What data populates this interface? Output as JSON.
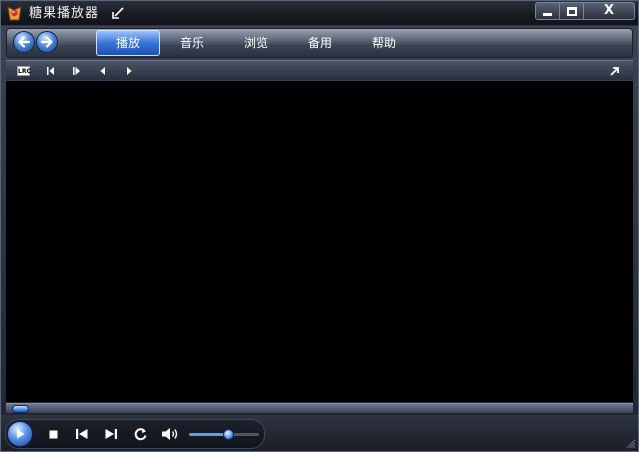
{
  "window": {
    "title": "糖果播放器",
    "controls": {
      "close_label": "X"
    }
  },
  "navigation": {
    "tabs": [
      {
        "label": "播放",
        "active": true
      },
      {
        "label": "音乐",
        "active": false
      },
      {
        "label": "浏览",
        "active": false
      },
      {
        "label": "备用",
        "active": false
      },
      {
        "label": "帮助",
        "active": false
      }
    ]
  },
  "toolbar": {
    "lyrics_label": "LRC"
  },
  "playback": {
    "seek_fraction": 0.0
  },
  "volume": {
    "fraction": 0.55
  },
  "icons": {
    "app": "candy-player-icon",
    "mini_mode": "mini-mode-icon",
    "back": "back-arrow-icon",
    "forward": "forward-arrow-icon",
    "lyrics": "lrc-icon",
    "frame_back": "frame-back-icon",
    "frame_forward": "frame-forward-icon",
    "step_back": "step-back-icon",
    "step_forward": "step-forward-icon",
    "expand": "expand-icon",
    "play": "play-icon",
    "stop": "stop-icon",
    "previous": "previous-icon",
    "next": "next-icon",
    "repeat": "repeat-icon",
    "volume": "speaker-icon"
  },
  "colors": {
    "accent": "#3a74d6",
    "chrome_dark": "#1a1e27",
    "video_background": "#000000"
  }
}
